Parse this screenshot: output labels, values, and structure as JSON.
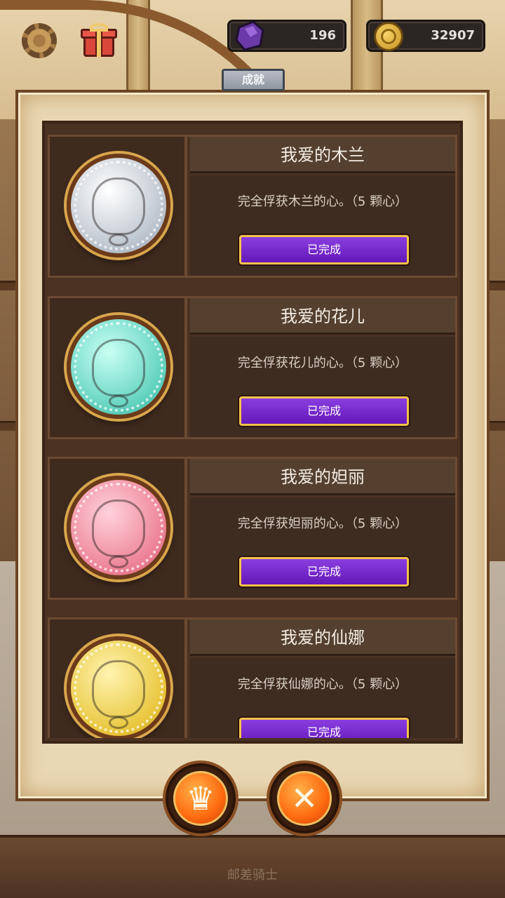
{
  "hud": {
    "gems": "196",
    "gold": "32907",
    "gem_icon": "purple-gem-icon",
    "coin_icon": "gold-coin-icon"
  },
  "panel": {
    "tab_label": "成就"
  },
  "achievements": [
    {
      "title": "我爱的木兰",
      "description": "完全俘获木兰的心。（5 颗心）",
      "button_label": "已完成",
      "medal": "silver-medal-icon"
    },
    {
      "title": "我爱的花儿",
      "description": "完全俘获花儿的心。（5 颗心）",
      "button_label": "已完成",
      "medal": "teal-medal-icon"
    },
    {
      "title": "我爱的妲丽",
      "description": "完全俘获妲丽的心。（5 颗心）",
      "button_label": "已完成",
      "medal": "pink-medal-icon"
    },
    {
      "title": "我爱的仙娜",
      "description": "完全俘获仙娜的心。（5 颗心）",
      "button_label": "已完成",
      "medal": "gold-medal-icon"
    }
  ],
  "bottom_buttons": {
    "crown_glyph": "♛",
    "close_glyph": "✕"
  },
  "footer": {
    "game_title": "邮差骑士"
  },
  "colors": {
    "button_purple": "#7a2ad0",
    "button_border": "#f2c34a",
    "action_orange": "#ff6a10"
  }
}
